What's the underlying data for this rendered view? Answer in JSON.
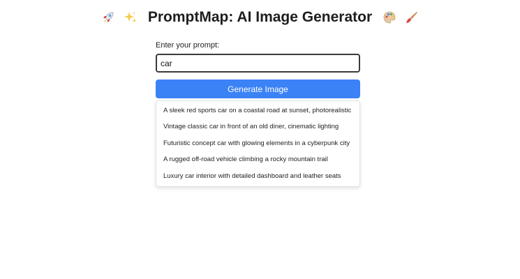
{
  "header": {
    "title": "PromptMap: AI Image Generator",
    "icons": [
      "rocket-icon",
      "sparkles-icon",
      "palette-icon",
      "paintbrush-icon"
    ]
  },
  "form": {
    "label": "Enter your prompt:",
    "input_value": "car",
    "button_label": "Generate Image"
  },
  "suggestions": [
    "A sleek red sports car on a coastal road at sunset, photorealistic",
    "Vintage classic car in front of an old diner, cinematic lighting",
    "Futuristic concept car with glowing elements in a cyberpunk city",
    "A rugged off-road vehicle climbing a rocky mountain trail",
    "Luxury car interior with detailed dashboard and leather seats"
  ],
  "colors": {
    "button_bg": "#3b82f6",
    "button_text": "#ffffff",
    "input_border": "#3a3a3a"
  }
}
